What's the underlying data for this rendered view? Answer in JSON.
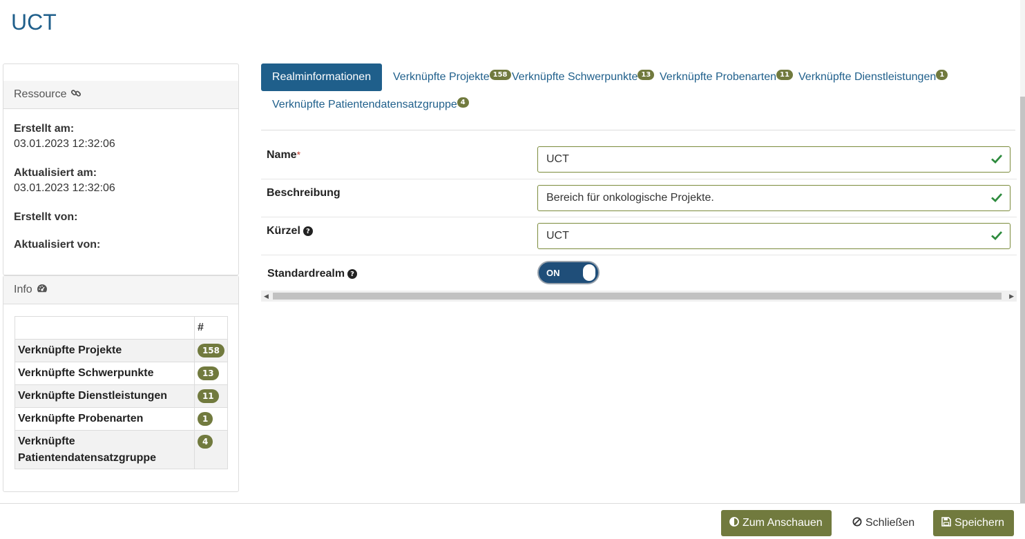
{
  "page": {
    "title": "UCT"
  },
  "resource": {
    "heading": "Ressource",
    "created_label": "Erstellt am:",
    "created_value": "03.01.2023 12:32:06",
    "updated_label": "Aktualisiert am:",
    "updated_value": "03.01.2023 12:32:06",
    "created_by_label": "Erstellt von:",
    "updated_by_label": "Aktualisiert von:"
  },
  "info": {
    "heading": "Info",
    "count_header": "#",
    "rows": [
      {
        "label": "Verknüpfte Projekte",
        "count": "158"
      },
      {
        "label": "Verknüpfte Schwerpunkte",
        "count": "13"
      },
      {
        "label": "Verknüpfte Dienstleistungen",
        "count": "11"
      },
      {
        "label": "Verknüpfte Probenarten",
        "count": "1"
      },
      {
        "label_line1": "Verknüpfte",
        "label_line2": "Patientendatensatzgruppe",
        "count": "4"
      }
    ]
  },
  "tabs": [
    {
      "label": "Realminformationen",
      "active": true
    },
    {
      "label": "Verknüpfte Projekte",
      "count": "158"
    },
    {
      "label": "Verknüpfte Schwerpunkte",
      "count": "13"
    },
    {
      "label": "Verknüpfte Probenarten",
      "count": "11"
    },
    {
      "label": "Verknüpfte Dienstleistungen",
      "count": "1"
    },
    {
      "label": "Verknüpfte Patientendatensatzgruppe",
      "count": "4"
    }
  ],
  "form": {
    "name_label": "Name",
    "name_required_mark": "*",
    "name_value": "UCT",
    "description_label": "Beschreibung",
    "description_value": "Bereich für onkologische Projekte.",
    "abbr_label": "Kürzel",
    "abbr_value": "UCT",
    "default_label": "Standardrealm",
    "default_toggle": "ON"
  },
  "footer": {
    "view_label": "Zum Anschauen",
    "close_label": "Schließen",
    "save_label": "Speichern"
  },
  "colors": {
    "primary": "#1f5f8b",
    "olive": "#717a3e",
    "valid": "#2e8b3e"
  },
  "icons": [
    "link-icon",
    "dashboard-icon",
    "question-icon",
    "check-icon",
    "contrast-icon",
    "ban-icon",
    "save-icon"
  ]
}
